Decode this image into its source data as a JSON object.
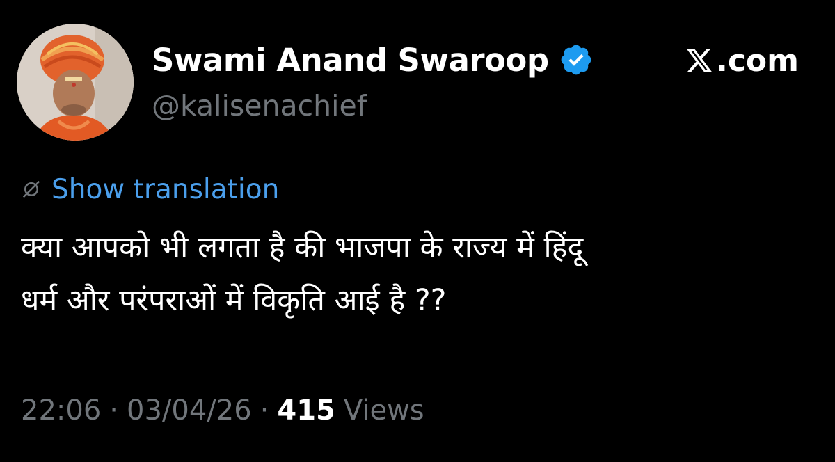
{
  "author": {
    "display_name": "Swami Anand Swaroop",
    "handle": "@kalisenachief",
    "verified": true,
    "verified_color": "#1d9bf0"
  },
  "site": {
    "label": ".com",
    "logo_icon": "x-logo-icon"
  },
  "translate": {
    "label": "Show translation",
    "icon": "globe-icon",
    "color": "#4b9fec"
  },
  "tweet": {
    "text_lines": [
      "क्या आपको भी लगता है की भाजपा के राज्य में हिंदू",
      "धर्म और परंपराओं में विकृति आई है ??"
    ]
  },
  "meta": {
    "time": "22:06",
    "separator": "·",
    "date": "03/04/26",
    "views_count": "415",
    "views_label": "Views"
  },
  "colors": {
    "background": "#000000",
    "text_primary": "#ffffff",
    "text_secondary": "#71767b",
    "link": "#4b9fec"
  }
}
